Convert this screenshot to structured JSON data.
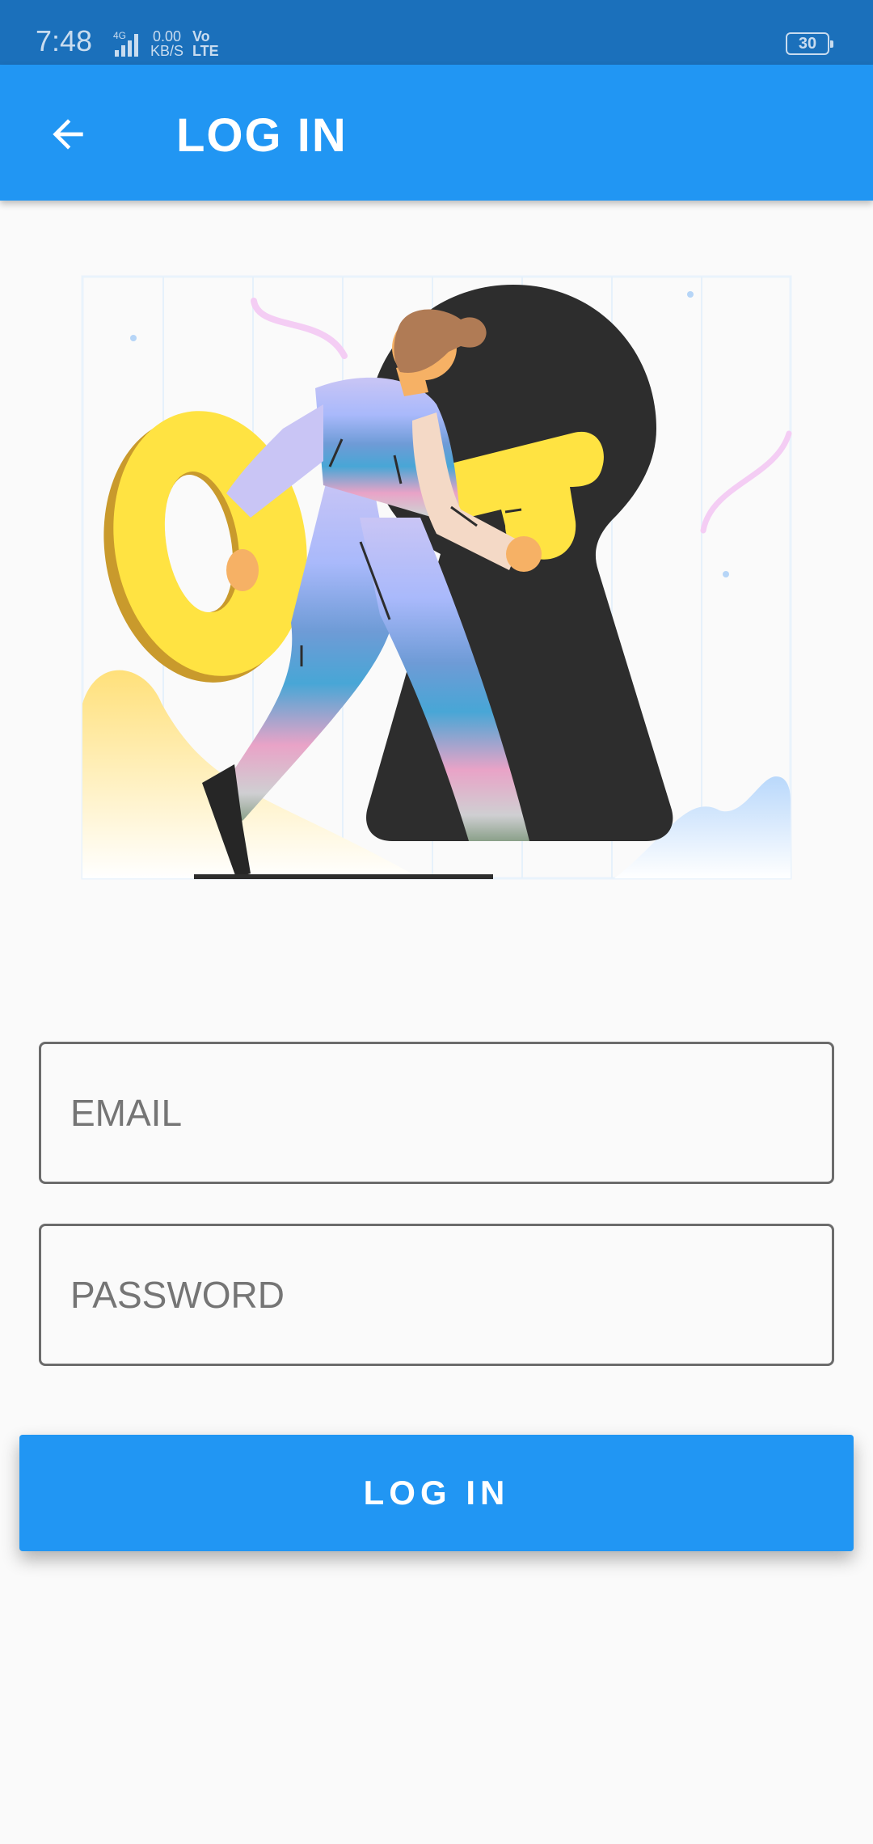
{
  "status_bar": {
    "time": "7:48",
    "network_type": "4G",
    "speed_value": "0.00",
    "speed_unit": "KB/S",
    "volte_top": "Vo",
    "volte_bottom": "LTE",
    "battery": "30"
  },
  "app_bar": {
    "back_icon": "arrow-left-icon",
    "title": "LOG IN"
  },
  "form": {
    "email_placeholder": "EMAIL",
    "email_value": "",
    "password_placeholder": "PASSWORD",
    "password_value": "",
    "submit_label": "LOG IN"
  },
  "colors": {
    "primary": "#2196f3",
    "status_bar": "#1b70bb",
    "background": "#fafafa",
    "key_yellow": "#ffe342",
    "keyhole_dark": "#2d2d2d"
  }
}
